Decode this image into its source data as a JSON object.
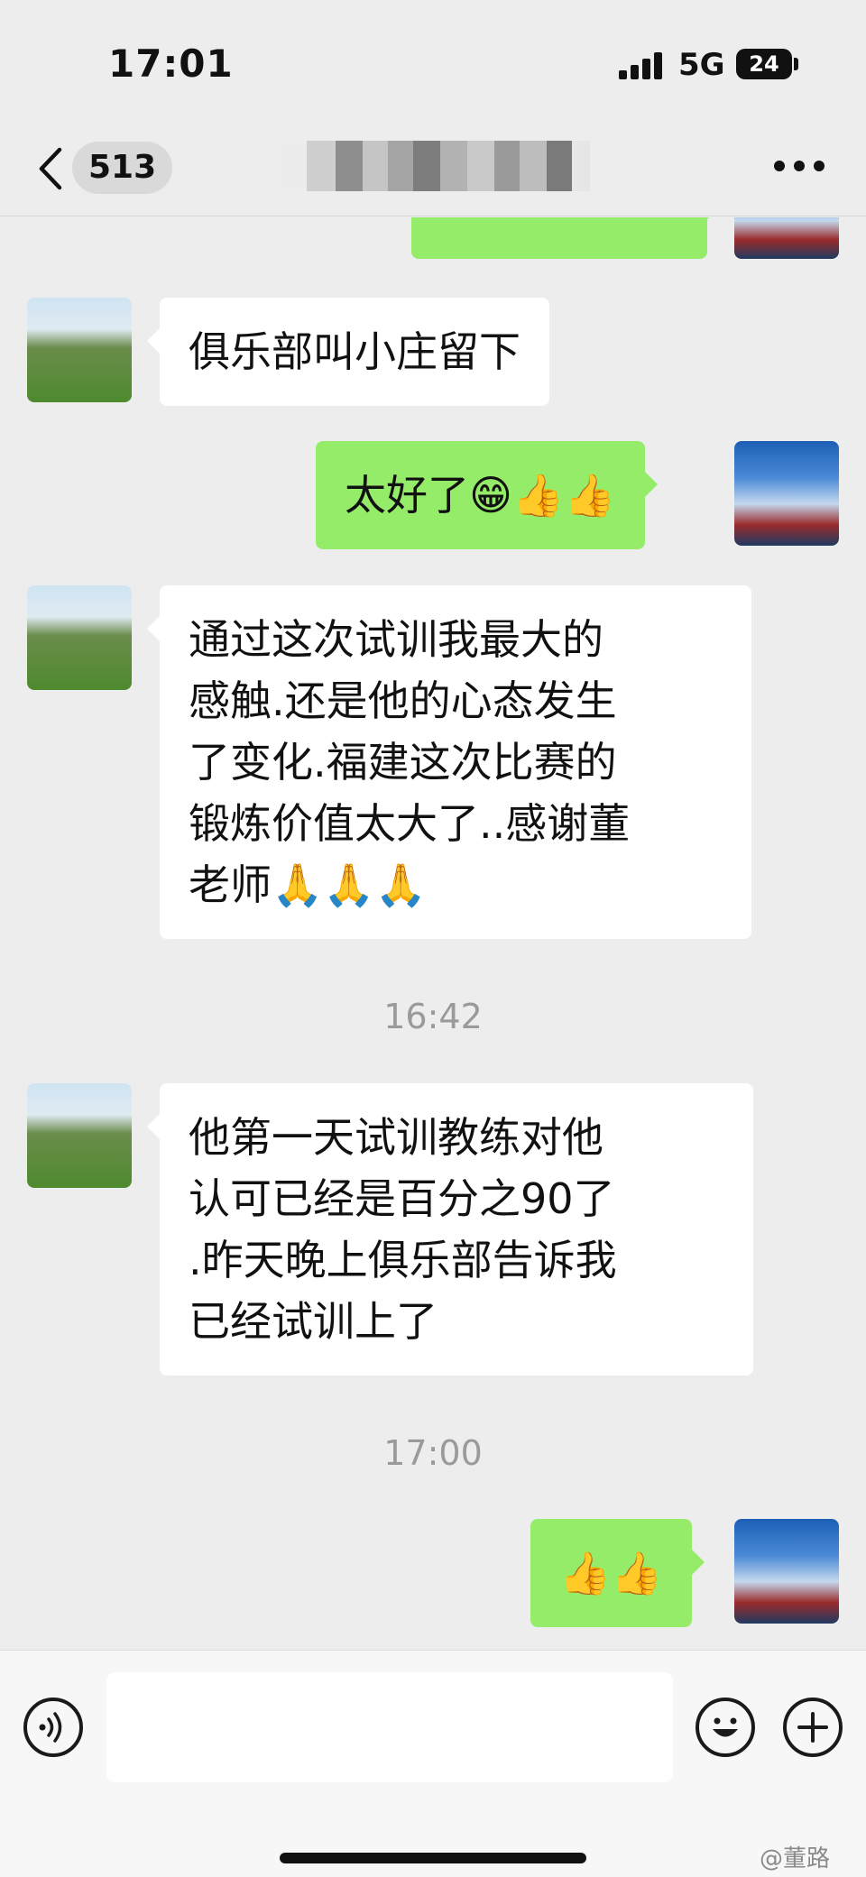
{
  "status_bar": {
    "time": "17:01",
    "network": "5G",
    "battery": "24"
  },
  "nav": {
    "unread_count": "513"
  },
  "messages": [
    {
      "sender": "me",
      "text": ""
    },
    {
      "sender": "friend",
      "text": "俱乐部叫小庄留下"
    },
    {
      "sender": "me",
      "text": "太好了😁👍👍"
    },
    {
      "sender": "friend",
      "text": "通过这次试训我最大的\n感触.还是他的心态发生\n了变化.福建这次比赛的\n锻炼价值太大了..感谢董\n老师🙏🙏🙏"
    },
    {
      "time": "16:42"
    },
    {
      "sender": "friend",
      "text": "他第一天试训教练对他\n认可已经是百分之90了\n.昨天晚上俱乐部告诉我\n已经试训上了"
    },
    {
      "time": "17:00"
    },
    {
      "sender": "me",
      "text": "👍👍"
    }
  ],
  "input": {
    "placeholder": ""
  },
  "watermark": "@董路",
  "colors": {
    "background": "#ededed",
    "bubble_self": "#95ec69",
    "bubble_other": "#ffffff",
    "timestamp": "#9a9a9a"
  },
  "icons": [
    "back-icon",
    "more-icon",
    "voice-icon",
    "emoji-icon",
    "plus-icon"
  ]
}
